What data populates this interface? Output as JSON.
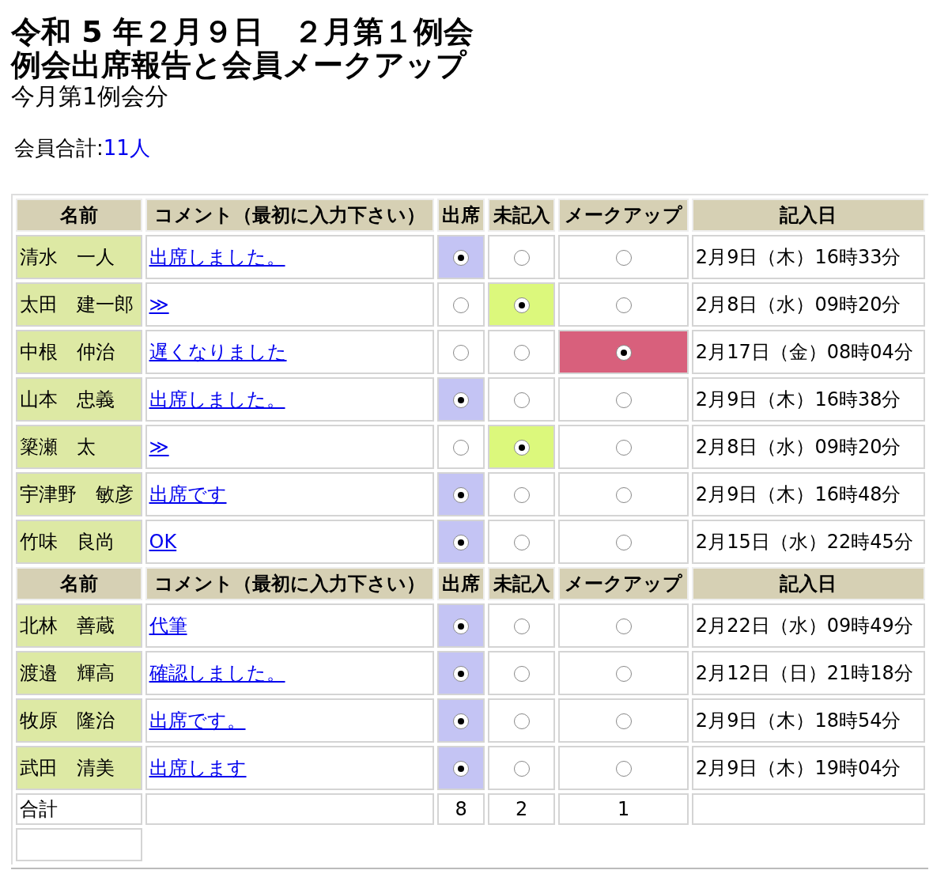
{
  "header": {
    "title": "令和 5 年２月９日　２月第１例会",
    "subtitle": "例会出席報告と会員メークアップ",
    "period": "今月第1例会分",
    "member_total_label": "会員合計:",
    "member_total": "11人"
  },
  "table": {
    "sections": [
      {
        "columns": [
          "名前",
          "コメント（最初に入力下さい）",
          "出席",
          "未記入",
          "メークアップ",
          "記入日"
        ],
        "rows": [
          {
            "name": "清水　一人",
            "comment": "出席しました。",
            "choices": [
              {
                "kind": "present",
                "selected": true
              },
              {
                "kind": "unrecorded",
                "selected": false
              },
              {
                "kind": "makeup",
                "selected": false
              }
            ],
            "date": "2月9日（木）16時33分"
          },
          {
            "name": "太田　建一郎",
            "comment": "≫",
            "choices": [
              {
                "kind": "present",
                "selected": false
              },
              {
                "kind": "unrecorded",
                "selected": true
              },
              {
                "kind": "makeup",
                "selected": false
              }
            ],
            "date": "2月8日（水）09時20分"
          },
          {
            "name": "中根　仲治",
            "comment": "遅くなりました",
            "choices": [
              {
                "kind": "present",
                "selected": false
              },
              {
                "kind": "unrecorded",
                "selected": false
              },
              {
                "kind": "makeup",
                "selected": true
              }
            ],
            "date": "2月17日（金）08時04分"
          },
          {
            "name": "山本　忠義",
            "comment": "出席しました。",
            "choices": [
              {
                "kind": "present",
                "selected": true
              },
              {
                "kind": "unrecorded",
                "selected": false
              },
              {
                "kind": "makeup",
                "selected": false
              }
            ],
            "date": "2月9日（木）16時38分"
          },
          {
            "name": "簗瀬　太",
            "comment": "≫",
            "choices": [
              {
                "kind": "present",
                "selected": false
              },
              {
                "kind": "unrecorded",
                "selected": true
              },
              {
                "kind": "makeup",
                "selected": false
              }
            ],
            "date": "2月8日（水）09時20分"
          },
          {
            "name": "宇津野　敏彦",
            "comment": "出席です",
            "choices": [
              {
                "kind": "present",
                "selected": true
              },
              {
                "kind": "unrecorded",
                "selected": false
              },
              {
                "kind": "makeup",
                "selected": false
              }
            ],
            "date": "2月9日（木）16時48分"
          },
          {
            "name": "竹味　良尚",
            "comment": "OK",
            "choices": [
              {
                "kind": "present",
                "selected": true
              },
              {
                "kind": "unrecorded",
                "selected": false
              },
              {
                "kind": "makeup",
                "selected": false
              }
            ],
            "date": "2月15日（水）22時45分"
          }
        ]
      },
      {
        "columns": [
          "名前",
          "コメント（最初に入力下さい）",
          "出席",
          "未記入",
          "メークアップ",
          "記入日"
        ],
        "rows": [
          {
            "name": "北林　善蔵",
            "comment": "代筆",
            "choices": [
              {
                "kind": "present",
                "selected": true
              },
              {
                "kind": "unrecorded",
                "selected": false
              },
              {
                "kind": "makeup",
                "selected": false
              }
            ],
            "date": "2月22日（水）09時49分"
          },
          {
            "name": "渡邉　輝高",
            "comment": "確認しました。",
            "choices": [
              {
                "kind": "present",
                "selected": true
              },
              {
                "kind": "unrecorded",
                "selected": false
              },
              {
                "kind": "makeup",
                "selected": false
              }
            ],
            "date": "2月12日（日）21時18分"
          },
          {
            "name": "牧原　隆治",
            "comment": "出席です。",
            "choices": [
              {
                "kind": "present",
                "selected": true
              },
              {
                "kind": "unrecorded",
                "selected": false
              },
              {
                "kind": "makeup",
                "selected": false
              }
            ],
            "date": "2月9日（木）18時54分"
          },
          {
            "name": "武田　清美",
            "comment": "出席します",
            "choices": [
              {
                "kind": "present",
                "selected": true
              },
              {
                "kind": "unrecorded",
                "selected": false
              },
              {
                "kind": "makeup",
                "selected": false
              }
            ],
            "date": "2月9日（木）19時04分"
          }
        ]
      }
    ],
    "totals": {
      "label": "合計",
      "values": [
        "8",
        "2",
        "1"
      ]
    }
  }
}
